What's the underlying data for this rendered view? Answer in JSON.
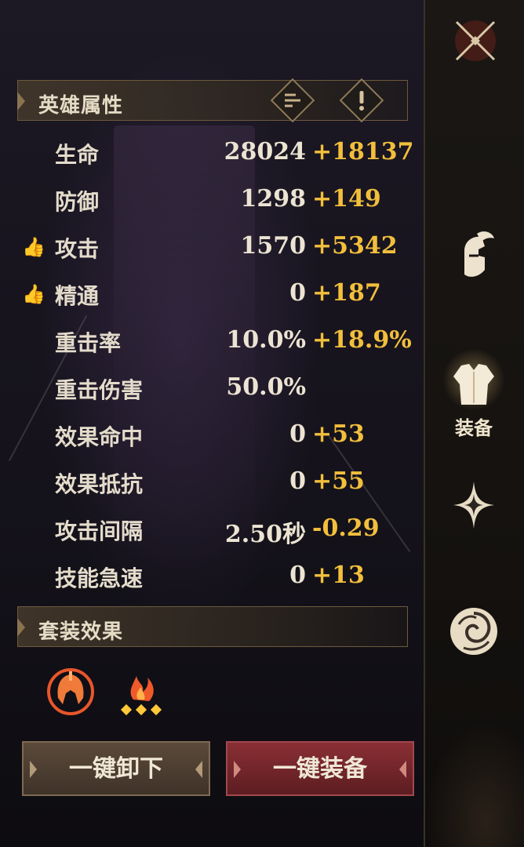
{
  "hero_attributes": {
    "title": "英雄属性",
    "sort_icon": "sort-lines-icon",
    "info_icon": "exclamation-icon"
  },
  "stats": [
    {
      "label": "生命",
      "base": "28024",
      "bonus": "+18137",
      "recommended": false
    },
    {
      "label": "防御",
      "base": "1298",
      "bonus": "+149",
      "recommended": false
    },
    {
      "label": "攻击",
      "base": "1570",
      "bonus": "+5342",
      "recommended": true
    },
    {
      "label": "精通",
      "base": "0",
      "bonus": "+187",
      "recommended": true
    },
    {
      "label": "重击率",
      "base": "10.0%",
      "bonus": "+18.9%",
      "recommended": false
    },
    {
      "label": "重击伤害",
      "base": "50.0%",
      "bonus": "",
      "recommended": false
    },
    {
      "label": "效果命中",
      "base": "0",
      "bonus": "+53",
      "recommended": false
    },
    {
      "label": "效果抵抗",
      "base": "0",
      "bonus": "+55",
      "recommended": false
    },
    {
      "label": "攻击间隔",
      "base": "2.50秒",
      "bonus": "-0.29",
      "recommended": false
    },
    {
      "label": "技能急速",
      "base": "0",
      "bonus": "+13",
      "recommended": false
    }
  ],
  "set_effects": {
    "title": "套装效果",
    "icons": [
      "spartan-helmet-icon",
      "flame-icon"
    ]
  },
  "buttons": {
    "unequip_all": "一键卸下",
    "equip_all": "一键装备"
  },
  "side_nav": {
    "items": [
      {
        "icon": "knight-helmet-icon",
        "label": ""
      },
      {
        "icon": "armor-icon",
        "label": "装备",
        "active": true
      },
      {
        "icon": "four-point-star-icon",
        "label": ""
      },
      {
        "icon": "swirl-icon",
        "label": ""
      }
    ],
    "close_icon": "close-crossed-swords-icon"
  },
  "colors": {
    "bonus": "#f2bf3c",
    "text": "#e4dccb",
    "accent_gold": "#f2c26a",
    "equip_button": "#8a2f34"
  }
}
